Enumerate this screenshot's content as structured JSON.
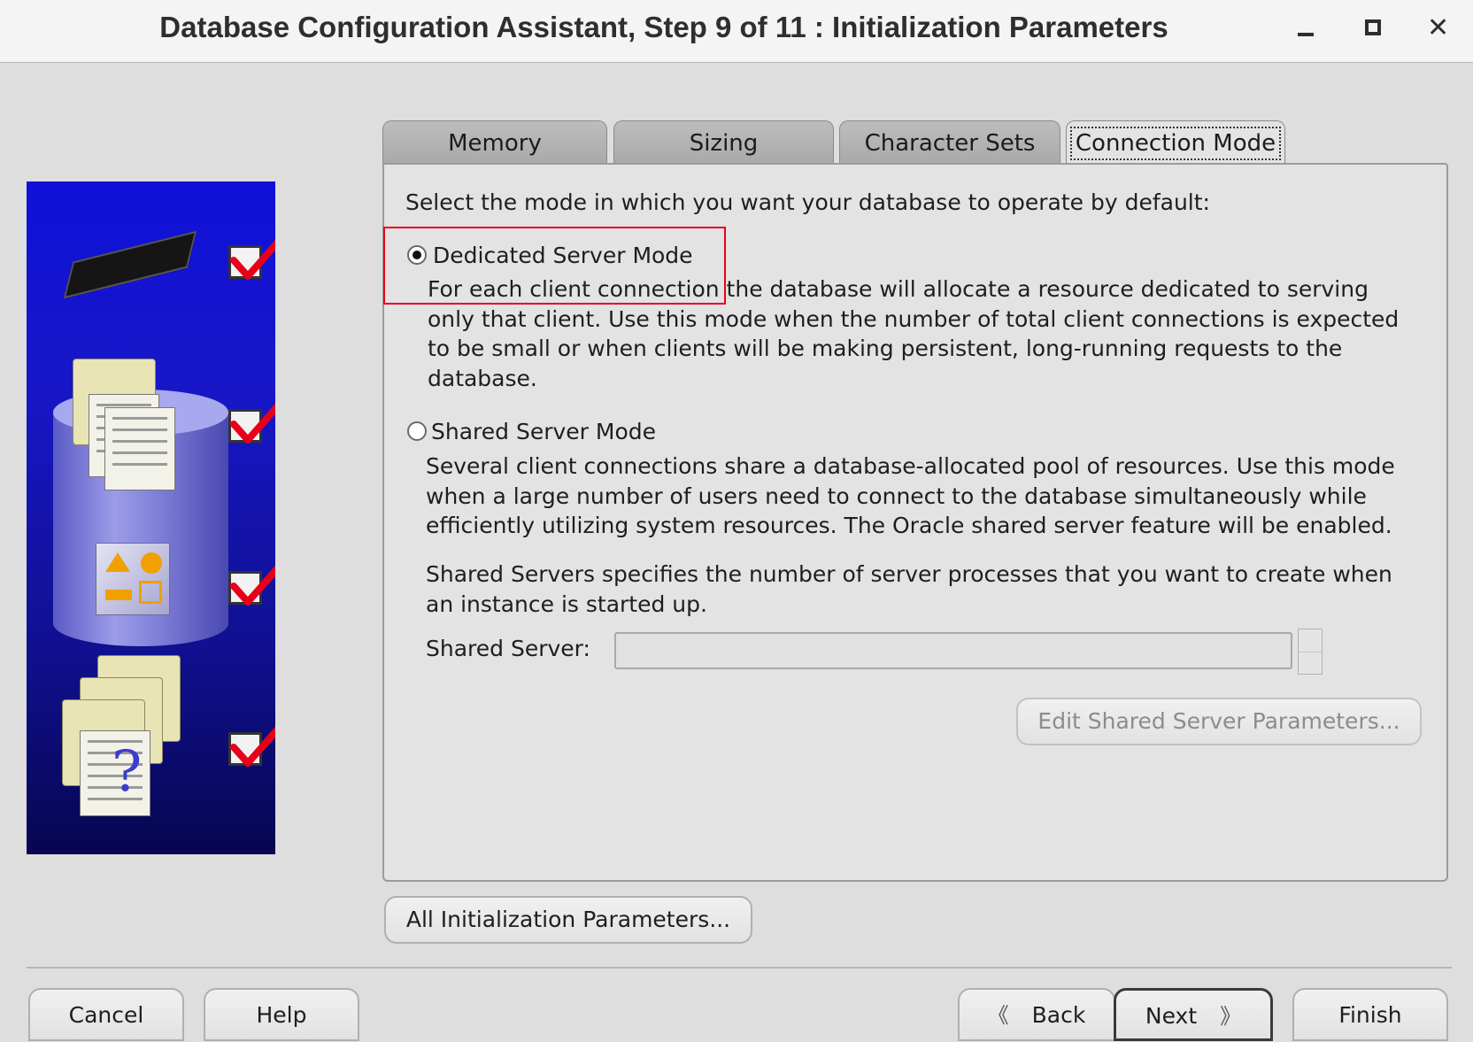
{
  "window": {
    "title": "Database Configuration Assistant, Step 9 of 11 : Initialization Parameters",
    "controls": [
      "minimize",
      "maximize",
      "close"
    ],
    "close_glyph": "✕"
  },
  "tabs": [
    {
      "label": "Memory",
      "active": false
    },
    {
      "label": "Sizing",
      "active": false
    },
    {
      "label": "Character Sets",
      "active": false
    },
    {
      "label": "Connection Mode",
      "active": true
    }
  ],
  "panel": {
    "prompt": "Select the mode in which you want your database to operate by default:",
    "dedicated": {
      "label": "Dedicated Server Mode",
      "selected": true,
      "description": "For each client connection the database will allocate a resource dedicated to serving\nonly that client.  Use this mode when the number of total client connections is expected\nto be small or when clients will be making persistent, long-running requests to the\ndatabase."
    },
    "shared": {
      "label": "Shared Server Mode",
      "selected": false,
      "description": "Several client connections share a database-allocated pool of resources.  Use this mode\nwhen a large number of users need to connect to the database simultaneously while\nefficiently utilizing system resources.  The Oracle shared server feature will be enabled.",
      "servers_note": "Shared Servers specifies the number of server processes that you want to create when\nan instance is started up.",
      "field_label": "Shared Server:",
      "field_value": "",
      "edit_button": "Edit Shared Server Parameters..."
    }
  },
  "all_params_button": "All Initialization Parameters...",
  "footer": {
    "cancel": "Cancel",
    "help": "Help",
    "back": "Back",
    "next": "Next",
    "finish": "Finish",
    "back_arrow": "《",
    "next_arrow": "》"
  },
  "highlight_color": "#e8001a"
}
